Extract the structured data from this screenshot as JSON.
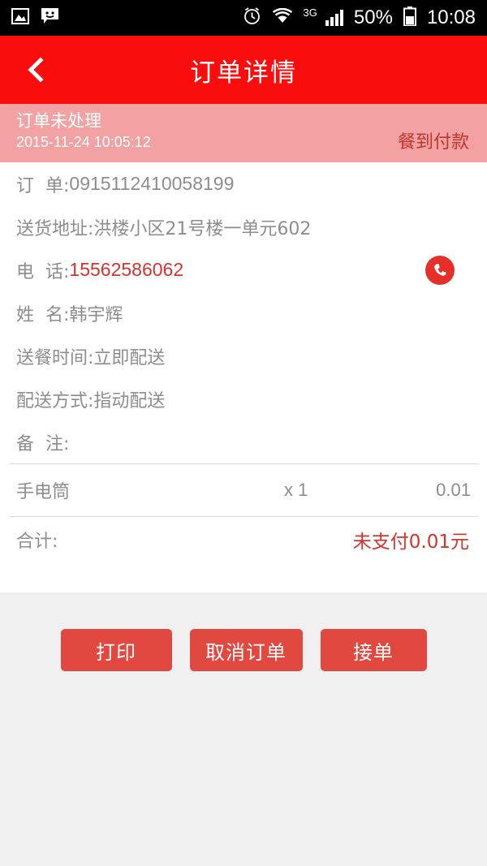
{
  "statusbar": {
    "icons_left": [
      "photo-icon",
      "message-smiley-icon"
    ],
    "icons_right": [
      "alarm-icon",
      "wifi-icon",
      "signal-icon",
      "battery-icon"
    ],
    "network": "3G",
    "battery": "50%",
    "time": "10:08"
  },
  "header": {
    "back_icon": "back-chevron-icon",
    "title": "订单详情"
  },
  "status_band": {
    "status": "订单未处理",
    "timestamp": "2015-11-24 10:05:12",
    "payment_type": "餐到付款",
    "bg_color": "#f2a2a2",
    "pay_color": "#c0342e"
  },
  "details": [
    {
      "label": "订  单:",
      "value": "0915112410058199",
      "kind": "order-no"
    },
    {
      "label": "送货地址:",
      "value": "洪楼小区21号楼一单元602",
      "kind": "text"
    },
    {
      "label": "电  话:",
      "value": "15562586062",
      "kind": "phone"
    },
    {
      "label": "姓  名:",
      "value": "韩宇辉",
      "kind": "text"
    },
    {
      "label": "送餐时间:",
      "value": "立即配送",
      "kind": "text"
    },
    {
      "label": "配送方式:",
      "value": "指动配送",
      "kind": "text"
    },
    {
      "label": "备  注:",
      "value": "",
      "kind": "text"
    }
  ],
  "call_button": {
    "icon": "phone-handset-icon",
    "color": "#e62f28"
  },
  "items": [
    {
      "name": "手电筒",
      "qty": "x 1",
      "price": "0.01"
    }
  ],
  "total": {
    "label": "合计:",
    "value": "未支付0.01元",
    "color": "#d8332e"
  },
  "actions": {
    "print_label": "打印",
    "cancel_label": "取消订单",
    "accept_label": "接单",
    "button_color": "#e04840"
  },
  "theme": {
    "header_red": "#fa0d0d",
    "text_gray": "#8d8d8d",
    "page_bg": "#f0f0f0"
  }
}
